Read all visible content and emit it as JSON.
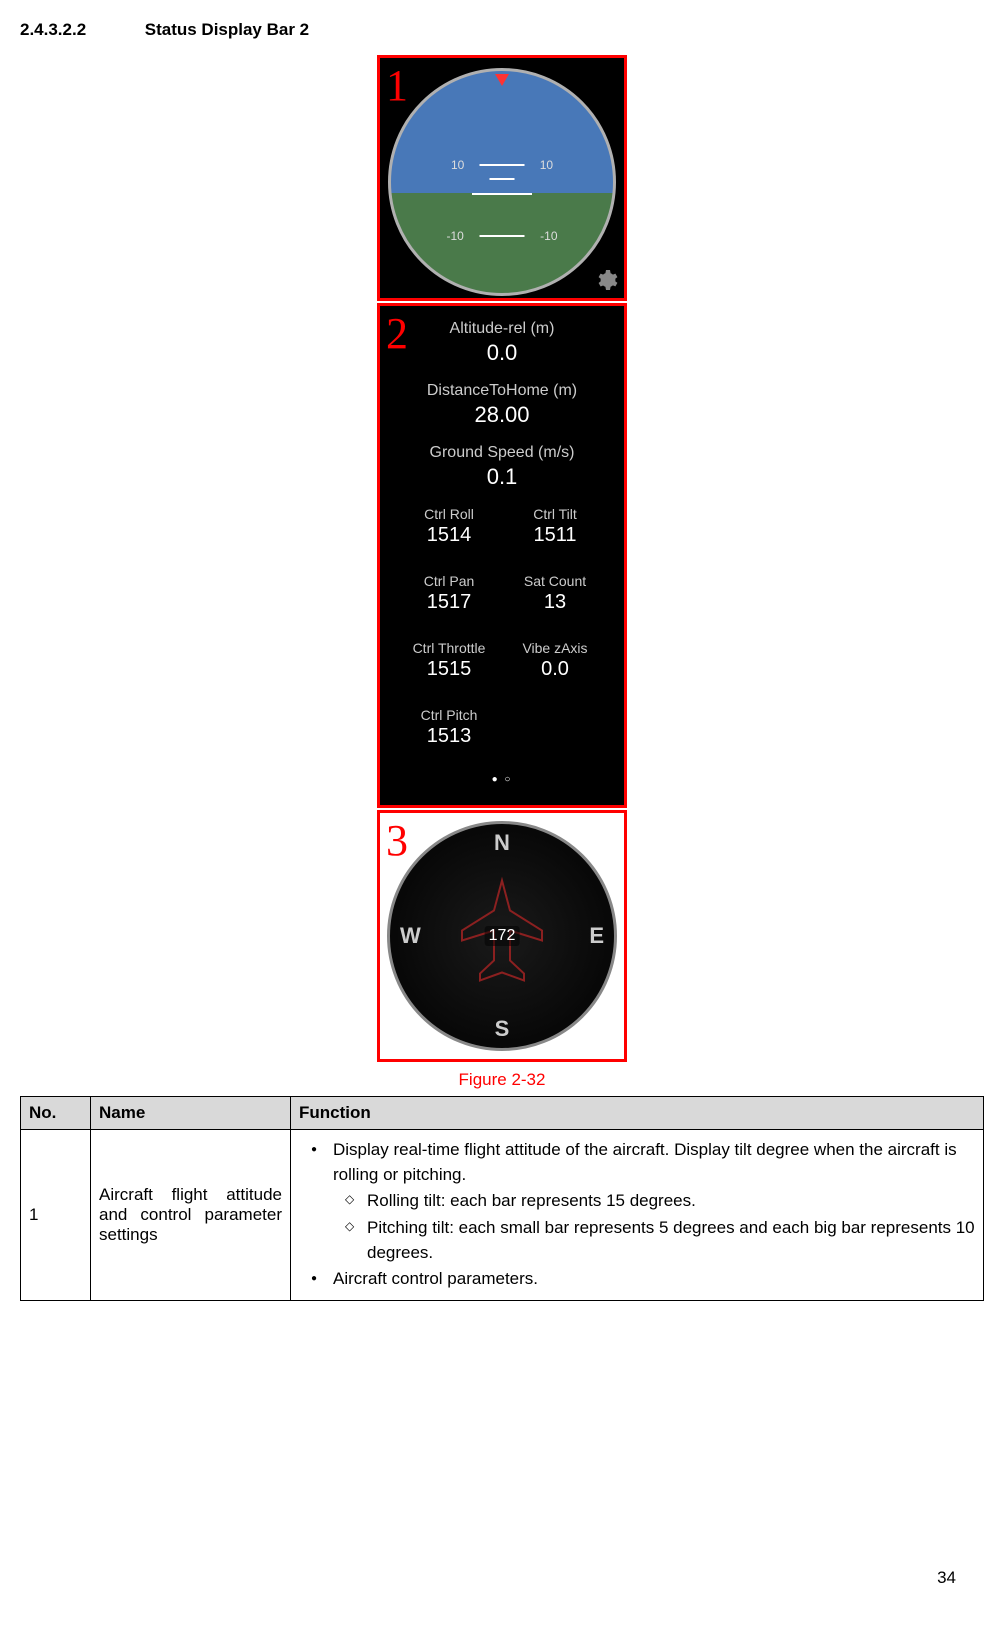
{
  "section": {
    "number": "2.4.3.2.2",
    "title": "Status Display Bar 2"
  },
  "figure": {
    "caption": "Figure 2-32"
  },
  "panel1": {
    "num": "1",
    "markers": {
      "u10L": "10",
      "u10R": "10",
      "d10L": "-10",
      "d10R": "-10"
    }
  },
  "panel2": {
    "num": "2",
    "altitude": {
      "label": "Altitude-rel (m)",
      "value": "0.0"
    },
    "distance": {
      "label": "DistanceToHome (m)",
      "value": "28.00"
    },
    "speed": {
      "label": "Ground Speed (m/s)",
      "value": "0.1"
    },
    "ctrlRoll": {
      "label": "Ctrl Roll",
      "value": "1514"
    },
    "ctrlTilt": {
      "label": "Ctrl Tilt",
      "value": "1511"
    },
    "ctrlPan": {
      "label": "Ctrl Pan",
      "value": "1517"
    },
    "satCount": {
      "label": "Sat Count",
      "value": "13"
    },
    "ctrlThrottle": {
      "label": "Ctrl Throttle",
      "value": "1515"
    },
    "vibeZ": {
      "label": "Vibe zAxis",
      "value": "0.0"
    },
    "ctrlPitch": {
      "label": "Ctrl Pitch",
      "value": "1513"
    }
  },
  "panel3": {
    "num": "3",
    "dirs": {
      "n": "N",
      "s": "S",
      "e": "E",
      "w": "W"
    },
    "heading": "172"
  },
  "table": {
    "headers": {
      "no": "No.",
      "name": "Name",
      "function": "Function"
    },
    "row1": {
      "no": "1",
      "name": "Aircraft flight attitude and control parameter settings",
      "b1": "Display real-time flight attitude of the aircraft. Display tilt degree when the aircraft is rolling or pitching.",
      "s1": "Rolling tilt: each bar represents 15 degrees.",
      "s2": "Pitching tilt: each small bar represents 5 degrees and each big bar represents 10 degrees.",
      "b2": "Aircraft control parameters."
    }
  },
  "pageNumber": "34"
}
